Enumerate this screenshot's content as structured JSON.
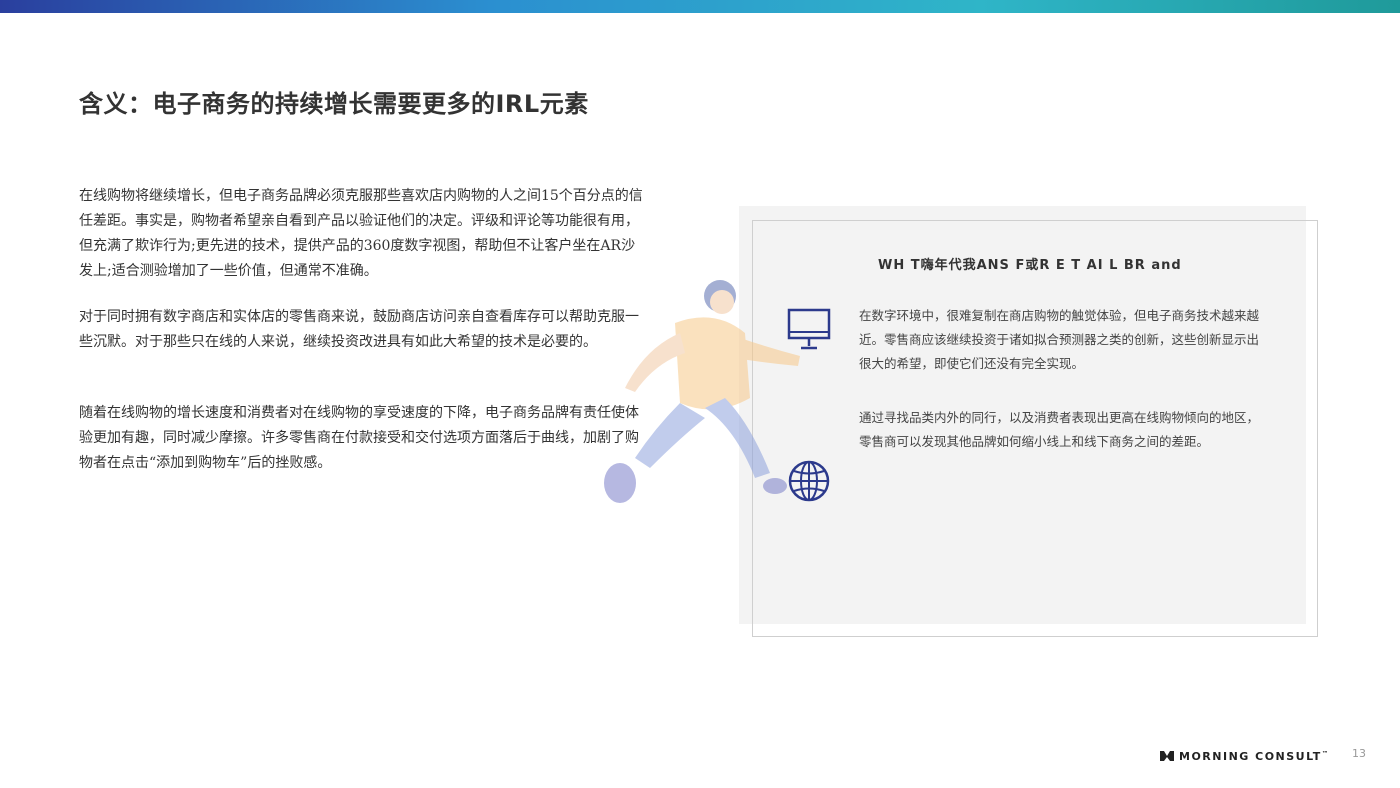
{
  "title": "含义：电子商务的持续增长需要更多的IRL元素",
  "paragraphs": [
    "在线购物将继续增长，但电子商务品牌必须克服那些喜欢店内购物的人之间15个百分点的信任差距。事实是，购物者希望亲自看到产品以验证他们的决定。评级和评论等功能很有用，但充满了欺诈行为;更先进的技术，提供产品的360度数字视图，帮助但不让客户坐在AR沙发上;适合测验增加了一些价值，但通常不准确。",
    "对于同时拥有数字商店和实体店的零售商来说，鼓励商店访问亲自查看库存可以帮助克服一些沉默。对于那些只在线的人来说，继续投资改进具有如此大希望的技术是必要的。",
    "随着在线购物的增长速度和消费者对在线购物的享受速度的下降，电子商务品牌有责任使体验更加有趣，同时减少摩擦。许多零售商在付款接受和交付选项方面落后于曲线，加剧了购物者在点击“添加到购物车”后的挫败感。"
  ],
  "panel": {
    "heading": "WH T嗨年代我ANS F或R E T AI L BR and",
    "items": [
      {
        "icon": "monitor-icon",
        "text": "在数字环境中，很难复制在商店购物的触觉体验，但电子商务技术越来越近。零售商应该继续投资于诸如拟合预测器之类的创新，这些创新显示出很大的希望，即使它们还没有完全实现。"
      },
      {
        "icon": "globe-icon",
        "text": "通过寻找品类内外的同行，以及消费者表现出更高在线购物倾向的地区，零售商可以发现其他品牌如何缩小线上和线下商务之间的差距。"
      }
    ]
  },
  "footer": {
    "logo_text": "MORNING CONSULT",
    "logo_tm": "™",
    "page_number": "13"
  },
  "colors": {
    "accent": "#2a3f9e",
    "icon": "#2c3a8c",
    "panel_bg": "#f3f3f3"
  }
}
